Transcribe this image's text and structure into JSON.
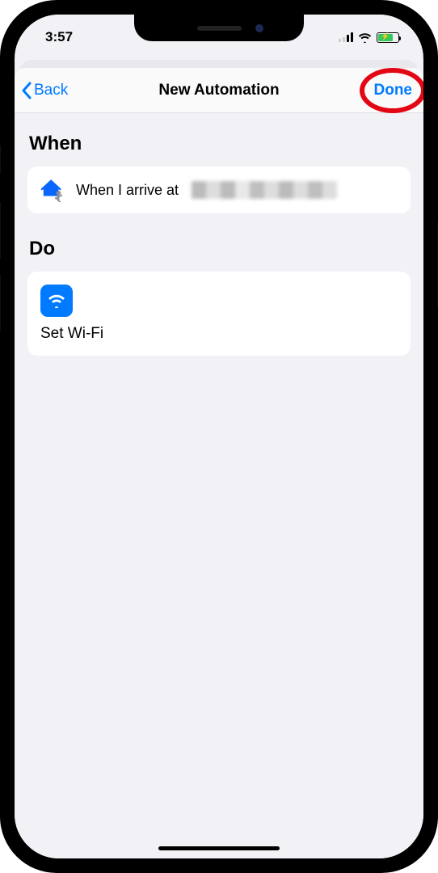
{
  "status": {
    "time": "3:57"
  },
  "nav": {
    "back_label": "Back",
    "title": "New Automation",
    "done_label": "Done"
  },
  "sections": {
    "when_title": "When",
    "when_condition": "When I arrive at",
    "do_title": "Do",
    "do_action": "Set Wi-Fi"
  }
}
